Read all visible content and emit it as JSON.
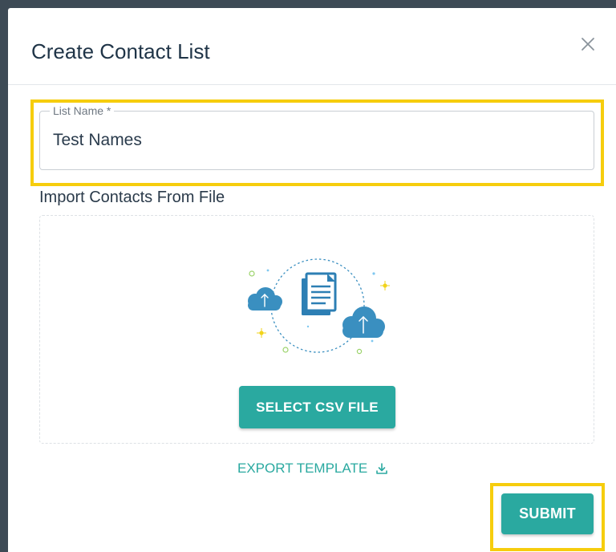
{
  "dialog": {
    "title": "Create Contact List",
    "close_icon": "close-icon"
  },
  "list_name": {
    "label": "List Name *",
    "value": "Test Names"
  },
  "import": {
    "heading": "Import Contacts From File",
    "illustration_icon": "cloud-upload-document-illustration",
    "select_button": "SELECT CSV FILE"
  },
  "export_link": {
    "label": "EXPORT TEMPLATE",
    "icon": "download-icon"
  },
  "submit_button": "SUBMIT",
  "colors": {
    "accent": "#2aa9a0",
    "highlight": "#f6cd0d",
    "title_text": "#1f3447",
    "illustration_blue": "#3a8fc0"
  }
}
